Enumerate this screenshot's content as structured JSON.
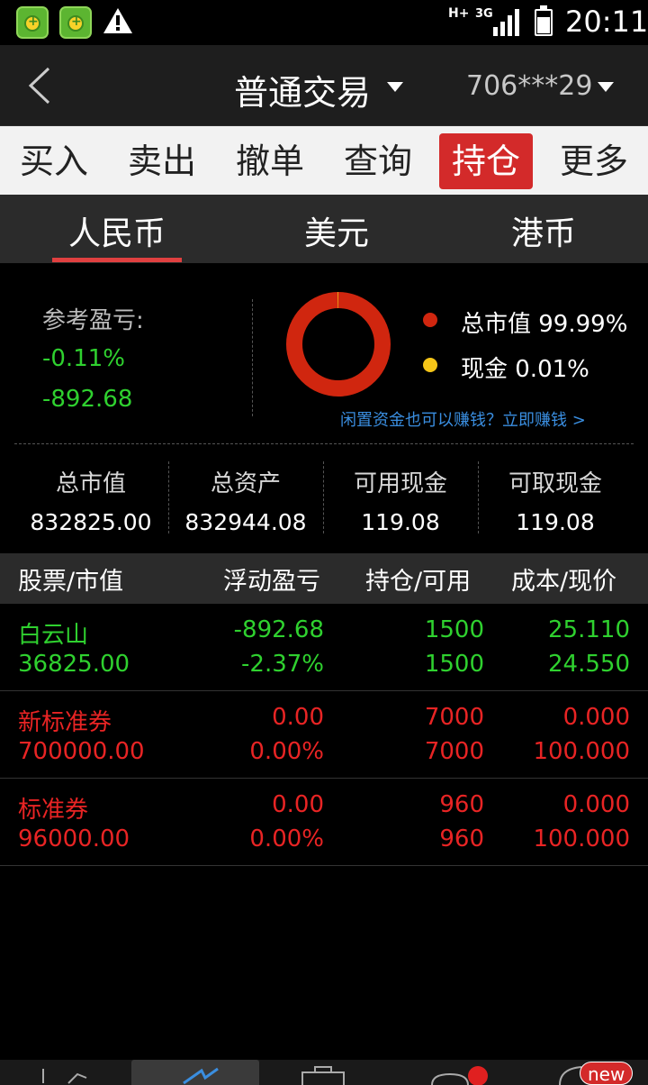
{
  "status_bar": {
    "network": "H+",
    "network_type": "3G",
    "time": "20:11",
    "icons": [
      "app-icon",
      "app-icon",
      "warning-icon",
      "signal-icon",
      "battery-icon"
    ]
  },
  "header": {
    "title": "普通交易",
    "account": "706***29"
  },
  "function_tabs": [
    {
      "label": "买入",
      "active": false
    },
    {
      "label": "卖出",
      "active": false
    },
    {
      "label": "撤单",
      "active": false
    },
    {
      "label": "查询",
      "active": false
    },
    {
      "label": "持仓",
      "active": true
    },
    {
      "label": "更多",
      "active": false
    }
  ],
  "currency_tabs": [
    {
      "label": "人民币",
      "active": true
    },
    {
      "label": "美元",
      "active": false
    },
    {
      "label": "港币",
      "active": false
    }
  ],
  "summary": {
    "ref_pl_label": "参考盈亏:",
    "ref_pl_pct": "-0.11%",
    "ref_pl_value": "-892.68",
    "legend": [
      {
        "label": "总市值 99.99%",
        "color": "#d0260f",
        "fraction": 0.9999
      },
      {
        "label": "现金 0.01%",
        "color": "#f5c518",
        "fraction": 0.0001
      }
    ],
    "promo": "闲置资金也可以赚钱？立即赚钱 >"
  },
  "stats": [
    {
      "label": "总市值",
      "value": "832825.00"
    },
    {
      "label": "总资产",
      "value": "832944.08"
    },
    {
      "label": "可用现金",
      "value": "119.08"
    },
    {
      "label": "可取现金",
      "value": "119.08"
    }
  ],
  "table": {
    "headers": [
      "股票/市值",
      "浮动盈亏",
      "持仓/可用",
      "成本/现价"
    ],
    "rows": [
      {
        "name": "白云山",
        "market_value": "36825.00",
        "pl": "-892.68",
        "pl_pct": "-2.37%",
        "position": "1500",
        "available": "1500",
        "cost": "25.110",
        "price": "24.550",
        "color": "green"
      },
      {
        "name": "新标准券",
        "market_value": "700000.00",
        "pl": "0.00",
        "pl_pct": "0.00%",
        "position": "7000",
        "available": "7000",
        "cost": "0.000",
        "price": "100.000",
        "color": "red"
      },
      {
        "name": "标准券",
        "market_value": "96000.00",
        "pl": "0.00",
        "pl_pct": "0.00%",
        "position": "960",
        "available": "960",
        "cost": "0.000",
        "price": "100.000",
        "color": "red"
      }
    ]
  },
  "bottom_nav": {
    "badge": "new"
  }
}
